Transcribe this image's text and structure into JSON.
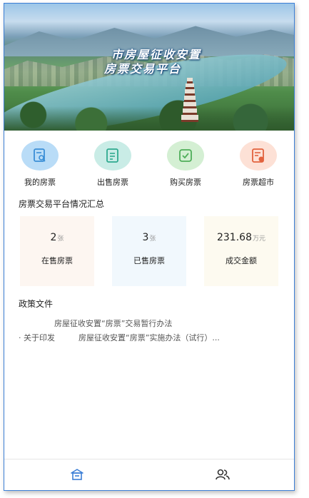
{
  "banner": {
    "title_line1": "市房屋征收安置",
    "title_line2": "房票交易平台"
  },
  "quick_actions": [
    {
      "label": "我的房票",
      "icon": "ticket-search-icon",
      "bg": "#b9dcf7",
      "fg": "#3b8fd6"
    },
    {
      "label": "出售房票",
      "icon": "ticket-list-icon",
      "bg": "#c9ece6",
      "fg": "#2fa98f"
    },
    {
      "label": "购买房票",
      "icon": "ticket-check-icon",
      "bg": "#d4efd3",
      "fg": "#4fae5a"
    },
    {
      "label": "房票超市",
      "icon": "ticket-chart-icon",
      "bg": "#fde1d6",
      "fg": "#e2623d"
    }
  ],
  "summary": {
    "title": "房票交易平台情况汇总",
    "stats": [
      {
        "value": "2",
        "unit": "张",
        "label": "在售房票",
        "bg": "#fdf6f1"
      },
      {
        "value": "3",
        "unit": "张",
        "label": "已售房票",
        "bg": "#f1f8fd"
      },
      {
        "value": "231.68",
        "unit": "万元",
        "label": "成交金额",
        "bg": "#fdfaf0"
      }
    ]
  },
  "policy": {
    "title": "政策文件",
    "items": [
      "房屋征收安置“房票”交易暂行办法",
      "· 关于印发　　　房屋征收安置“房票”实施办法（试行）..."
    ]
  },
  "tabbar": {
    "tabs": [
      {
        "icon": "home-icon",
        "active": true
      },
      {
        "icon": "users-icon",
        "active": false
      }
    ]
  },
  "colors": {
    "accent": "#3c7fd6"
  }
}
